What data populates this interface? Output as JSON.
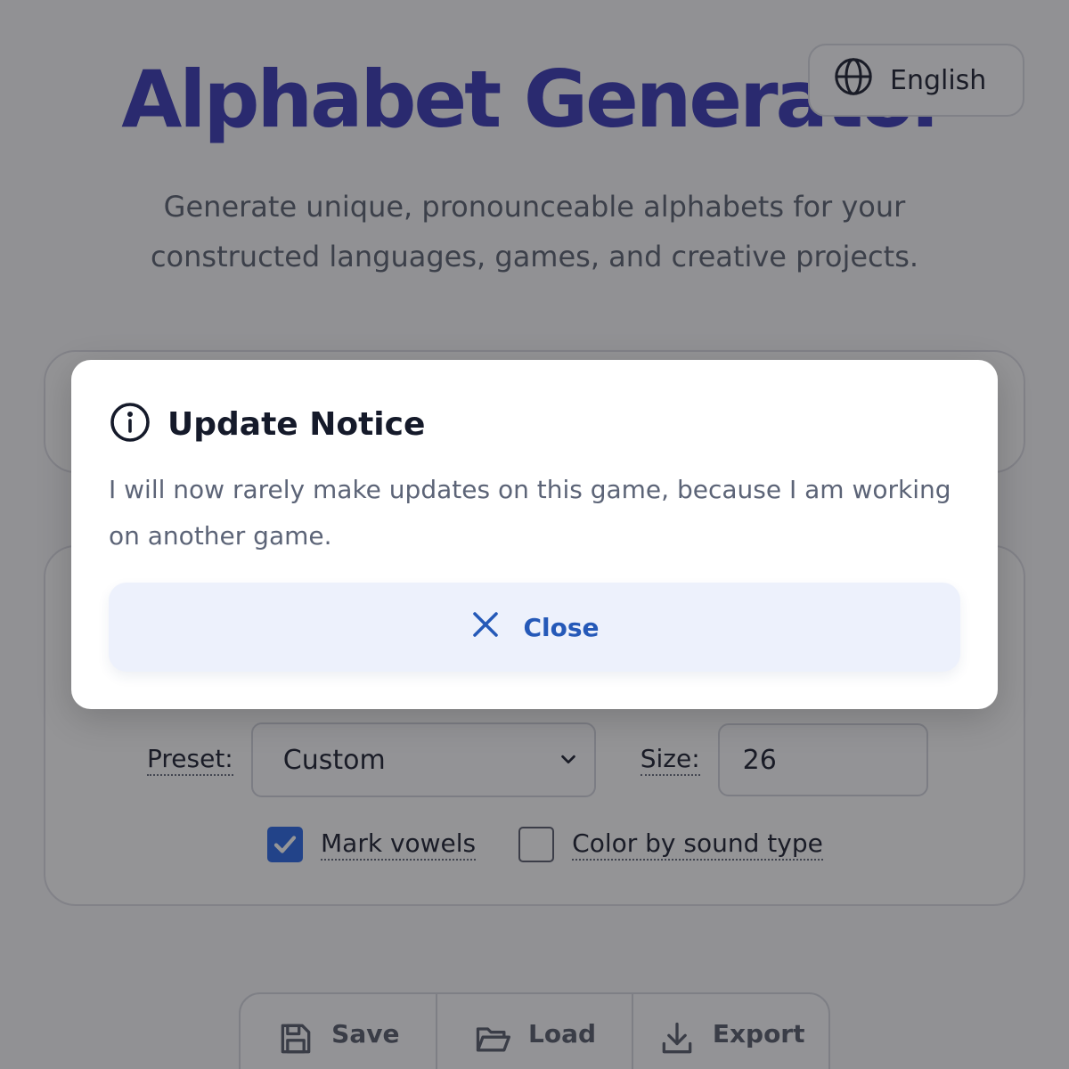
{
  "header": {
    "title": "Alphabet Generator",
    "subtitle": "Generate unique, pronounceable alphabets for your constructed languages, games, and creative projects."
  },
  "language": {
    "label": "English",
    "icon": "globe-icon"
  },
  "settings": {
    "preset_label": "Preset:",
    "preset_value": "Custom",
    "size_label": "Size:",
    "size_value": "26",
    "mark_vowels_label": "Mark vowels",
    "mark_vowels_checked": true,
    "color_by_sound_label": "Color by sound type",
    "color_by_sound_checked": false
  },
  "toolbar": {
    "save_label": "Save",
    "load_label": "Load",
    "export_label": "Export"
  },
  "modal": {
    "title": "Update Notice",
    "body": "I will now rarely make updates on this game, because I am working on another game.",
    "close_label": "Close",
    "icon": "info-icon"
  },
  "colors": {
    "title": "#3d3cb6",
    "accent": "#2559b8",
    "checkbox": "#2e6be6"
  }
}
